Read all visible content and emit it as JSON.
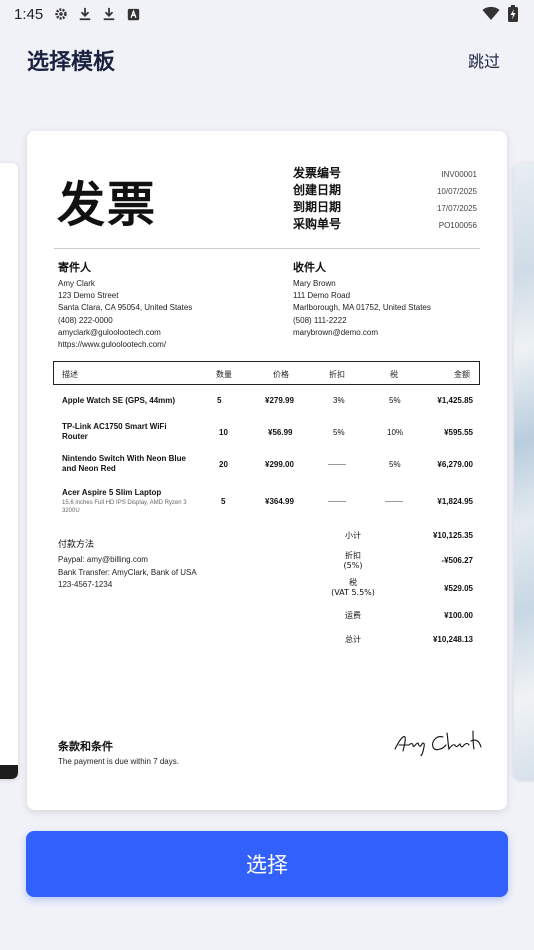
{
  "status_bar": {
    "time": "1:45",
    "left_icons": [
      "gear-icon",
      "download-icon",
      "download-icon",
      "sim-a-icon"
    ],
    "right_icons": [
      "wifi-icon",
      "battery-charging-icon"
    ]
  },
  "header": {
    "title": "选择模板",
    "skip_label": "跳过"
  },
  "invoice": {
    "title": "发票",
    "meta": [
      {
        "label": "发票编号",
        "value": "INV00001"
      },
      {
        "label": "创建日期",
        "value": "10/07/2025"
      },
      {
        "label": "到期日期",
        "value": "17/07/2025"
      },
      {
        "label": "采购单号",
        "value": "PO100056"
      }
    ],
    "sender": {
      "heading": "寄件人",
      "lines": [
        "Amy Clark",
        "123 Demo Street",
        "Santa Clara, CA 95054, United States",
        "(408) 222-0000",
        "amyclark@guloolootech.com",
        "https://www.guloolootech.com/"
      ]
    },
    "recipient": {
      "heading": "收件人",
      "lines": [
        "Mary Brown",
        "111 Demo Road",
        "Marlborough, MA 01752, United States",
        "(508) 111-2222",
        "marybrown@demo.com"
      ]
    },
    "columns": {
      "description": "描述",
      "quantity": "数量",
      "price": "价格",
      "discount": "折扣",
      "tax": "税",
      "amount": "金额"
    },
    "items": [
      {
        "name": "Apple Watch SE (GPS, 44mm)",
        "note": "",
        "qty": "5",
        "price": "¥279.99",
        "discount": "3%",
        "tax": "5%",
        "amount": "¥1,425.85"
      },
      {
        "name": "TP-Link AC1750 Smart WiFi Router",
        "note": "",
        "qty": "10",
        "price": "¥56.99",
        "discount": "5%",
        "tax": "10%",
        "amount": "¥595.55"
      },
      {
        "name": "Nintendo Switch With Neon Blue and Neon Red",
        "note": "",
        "qty": "20",
        "price": "¥299.00",
        "discount": "",
        "tax": "5%",
        "amount": "¥6,279.00"
      },
      {
        "name": "Acer Aspire 5 Slim Laptop",
        "note": "15.6 inches Full HD IPS Display, AMD Ryzen 3 3200U",
        "qty": "5",
        "price": "¥364.99",
        "discount": "",
        "tax": "",
        "amount": "¥1,824.95"
      }
    ],
    "payment": {
      "heading": "付款方法",
      "lines": [
        "Paypal: amy@billing.com",
        "Bank Transfer: AmyClark, Bank of USA",
        "123-4567-1234"
      ]
    },
    "totals": [
      {
        "label": "小计",
        "value": "¥10,125.35"
      },
      {
        "label": "折扣\n(5%)",
        "value": "-¥506.27"
      },
      {
        "label": "税\n(VAT 5.5%)",
        "value": "¥529.05"
      },
      {
        "label": "运费",
        "value": "¥100.00"
      },
      {
        "label": "总计",
        "value": "¥10,248.13"
      }
    ],
    "terms": {
      "heading": "条款和条件",
      "text": "The payment is due within 7 days."
    },
    "signature": "Amy Clark"
  },
  "select_button": {
    "label": "选择"
  },
  "colors": {
    "background": "#f1f2f8",
    "accent": "#3260fb",
    "title": "#1b2340"
  }
}
